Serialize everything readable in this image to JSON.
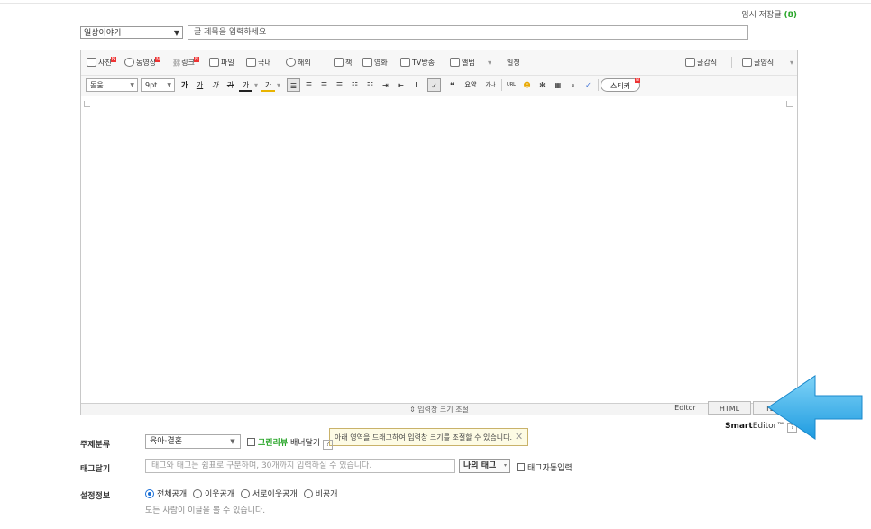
{
  "header": {
    "temp_save_label": "임시 저장글",
    "temp_save_count": "(8)"
  },
  "post": {
    "category_value": "일상이야기",
    "title_placeholder": "글 제목을 입력하세요"
  },
  "toolbar1": {
    "photo": "사진",
    "video": "동영상",
    "link": "링크",
    "file": "파일",
    "domestic": "국내",
    "overseas": "해외",
    "book": "책",
    "movie": "영화",
    "tv": "TV방송",
    "album": "앨범",
    "schedule": "일정",
    "template": "글감식",
    "format": "글양식"
  },
  "toolbar2": {
    "font": "돋움",
    "size": "9pt",
    "bold": "가",
    "underline": "가",
    "italic": "가",
    "strike": "가",
    "color": "가",
    "bg": "가",
    "quote": "❝",
    "summary": "요약",
    "ruby": "가나",
    "url": "URL",
    "sticker": "스티커"
  },
  "editor": {
    "tooltip": "아래 영역을 드래그하여 입력창 크기를 조절할 수 있습니다.",
    "resize_label": "⇕ 입력창 크기 조절",
    "modes": [
      "Editor",
      "HTML",
      "TEXT"
    ],
    "brand_bold": "Smart",
    "brand_rest": "Editor™"
  },
  "form": {
    "topic_label": "주제분류",
    "topic_value": "육아·결혼",
    "green_review": "그린리뷰",
    "banner": "배너달기",
    "help": "?",
    "tag_label": "태그달기",
    "tag_placeholder": "태그와 태그는 쉼표로 구분하며, 30개까지 입력하실 수 있습니다.",
    "my_tags": "나의 태그",
    "auto_tag": "태그자동입력",
    "settings_label": "설정정보",
    "visibility": [
      "전체공개",
      "이웃공개",
      "서로이웃공개",
      "비공개"
    ],
    "visibility_note": "모든 사람이 이글을 볼 수 있습니다."
  },
  "colors": {
    "accent_green": "#2aa62a",
    "arrow_blue": "#2aa9e8"
  }
}
